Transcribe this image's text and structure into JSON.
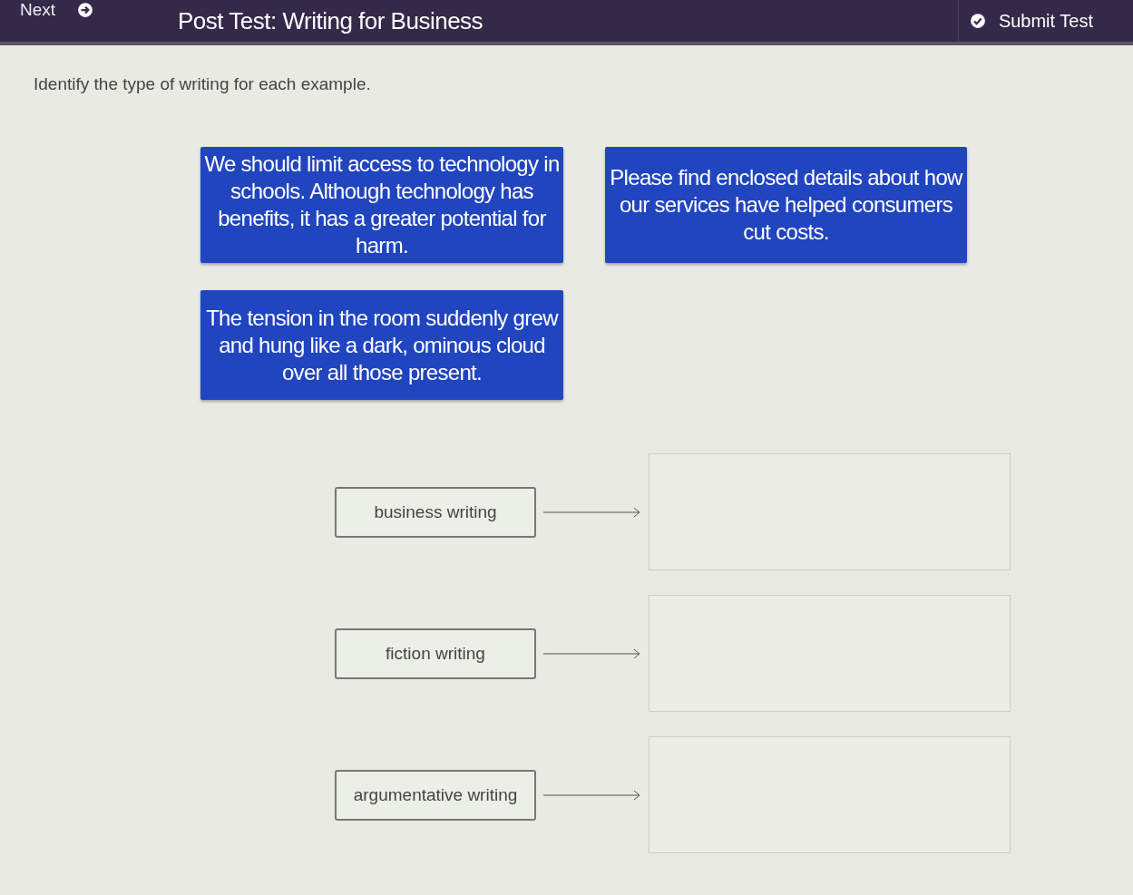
{
  "header": {
    "next": "Next",
    "title": "Post Test: Writing for Business",
    "submit": "Submit Test"
  },
  "instruction": "Identify the type of writing for each example.",
  "examples": [
    {
      "text": "We should limit access to technology in schools. Although technology has benefits, it has a greater potential for harm."
    },
    {
      "text": "Please find enclosed details about how our services have helped consumers cut costs."
    },
    {
      "text": "The tension in the room suddenly grew and hung like a dark, ominous cloud over all those present."
    }
  ],
  "targets": [
    {
      "label": "business writing"
    },
    {
      "label": "fiction writing"
    },
    {
      "label": "argumentative writing"
    }
  ]
}
